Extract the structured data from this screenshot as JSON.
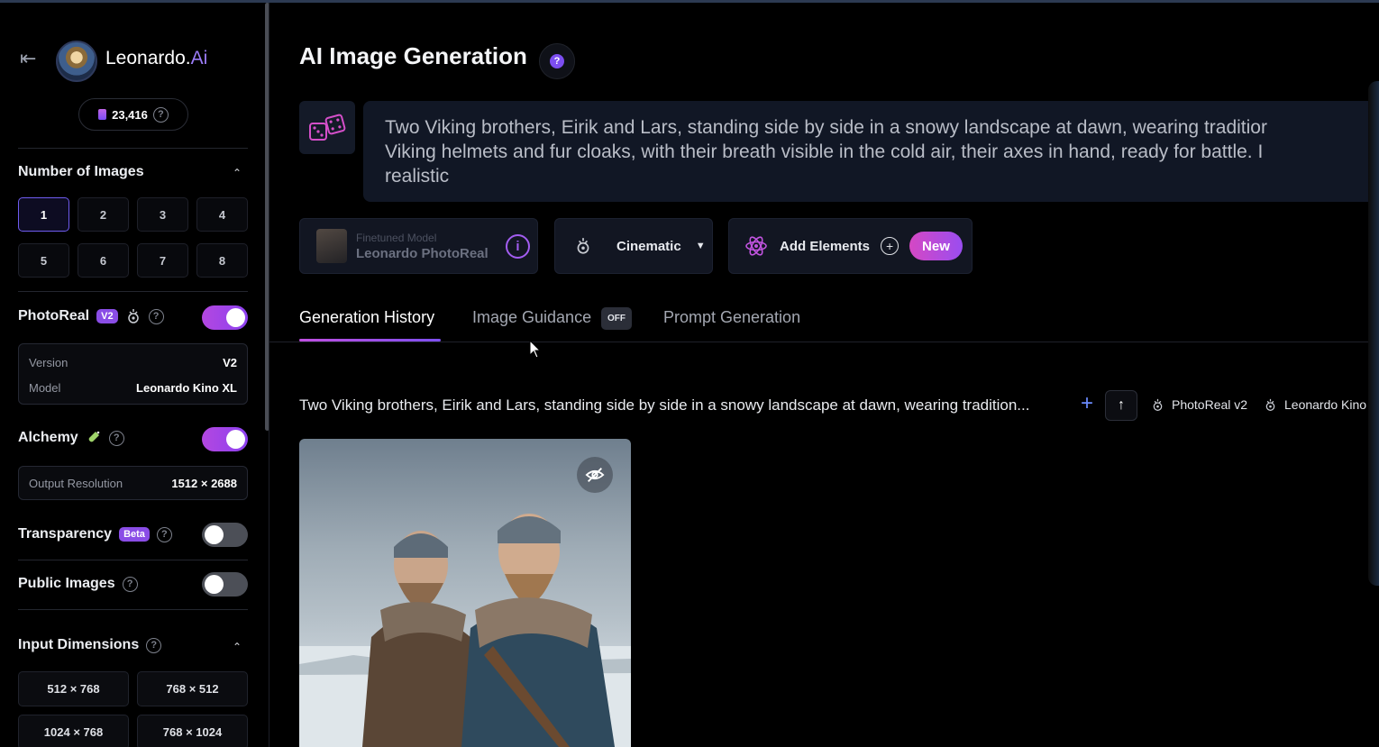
{
  "app": {
    "brand_name": "Leonardo.",
    "brand_suffix": "Ai",
    "tokens": "23,416"
  },
  "sidebar": {
    "num_images": {
      "title": "Number of Images",
      "options": [
        "1",
        "2",
        "3",
        "4",
        "5",
        "6",
        "7",
        "8"
      ],
      "selected": "1"
    },
    "photoreal": {
      "label": "PhotoReal",
      "badge": "V2",
      "enabled": true,
      "version_label": "Version",
      "version_value": "V2",
      "model_label": "Model",
      "model_value": "Leonardo Kino XL"
    },
    "alchemy": {
      "label": "Alchemy",
      "enabled": true,
      "res_label": "Output Resolution",
      "res_value": "1512 × 2688"
    },
    "transparency": {
      "label": "Transparency",
      "badge": "Beta",
      "enabled": false
    },
    "public_images": {
      "label": "Public Images",
      "enabled": false
    },
    "input_dimensions": {
      "title": "Input Dimensions",
      "options": [
        "512 × 768",
        "768 × 512",
        "1024 × 768",
        "768 × 1024"
      ]
    }
  },
  "main": {
    "title": "AI Image Generation",
    "help_icon_text": "?",
    "prompt_lines": [
      "Two Viking brothers, Eirik and Lars, standing side by side in a snowy landscape at dawn, wearing traditior",
      "Viking helmets and fur cloaks, with their breath visible in the cold air, their axes in hand, ready for battle. I",
      "realistic"
    ],
    "finetuned": {
      "small": "Finetuned Model",
      "name": "Leonardo PhotoReal",
      "info_icon_text": "i"
    },
    "style": {
      "label": "Cinematic"
    },
    "elements": {
      "label": "Add Elements",
      "new_badge": "New"
    },
    "tabs": [
      {
        "label": "Generation History",
        "active": true
      },
      {
        "label": "Image Guidance",
        "badge": "OFF",
        "active": false
      },
      {
        "label": "Prompt Generation",
        "active": false
      }
    ],
    "history": {
      "prompt": "Two Viking brothers, Eirik and Lars, standing side by side in a snowy landscape at dawn, wearing tradition...",
      "tags": [
        "PhotoReal v2",
        "Leonardo Kino"
      ]
    }
  },
  "icons": {
    "back": "back-arrow-icon",
    "help": "question-icon",
    "dice": "dice-icon",
    "info": "info-icon",
    "style": "cinematic-icon",
    "elements": "atom-icon",
    "plus": "plus-icon",
    "upload": "arrow-up-icon",
    "hide": "eye-off-icon"
  },
  "colors": {
    "accent": "#8d41f0",
    "pink": "#d548c4",
    "prompt_bg": "#111725"
  }
}
